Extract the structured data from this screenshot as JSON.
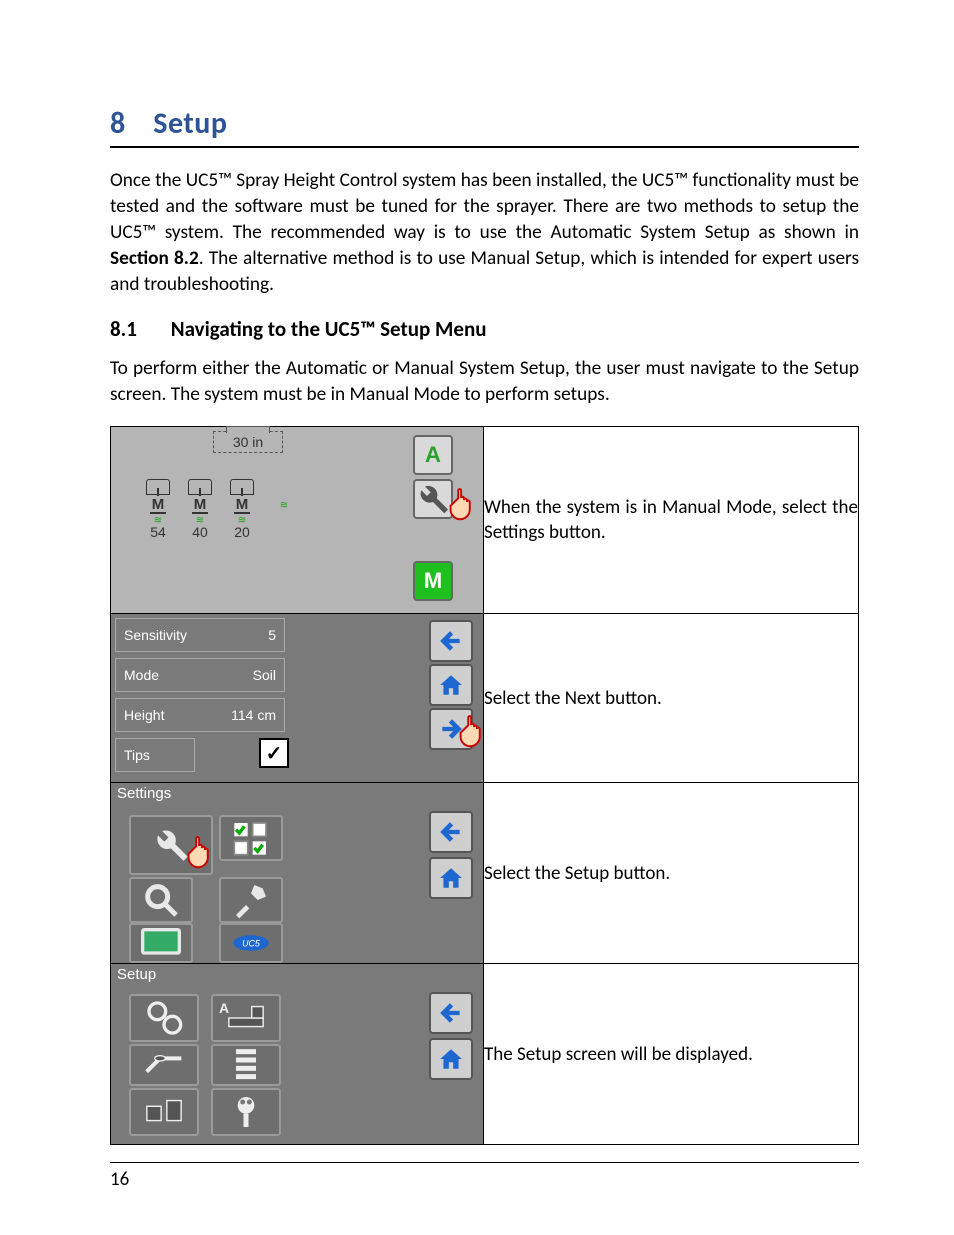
{
  "section": {
    "number": "8",
    "title": "Setup"
  },
  "intro": {
    "text_a": "Once the UC5™ Spray Height Control system has been installed, the UC5™ functionality must be tested and the software must be tuned for the sprayer.  There are two methods to setup the UC5™ system.  The recommended way is to use the Automatic System Setup as shown in ",
    "bold": "Section 8.2",
    "text_b": ".   The alternative method is to use Manual Setup, which is intended for expert users and troubleshooting."
  },
  "subsection": {
    "number": "8.1",
    "title": "Navigating to the UC5™ Setup Menu"
  },
  "sub_intro": "To perform either the Automatic or Manual System Setup, the user must navigate to the Setup screen. The system must be in Manual Mode to perform setups.",
  "steps": [
    {
      "caption": "When the system is in Manual Mode, select the Settings button."
    },
    {
      "caption": "Select the Next button."
    },
    {
      "caption": "Select the Setup button."
    },
    {
      "caption": "The Setup screen will be displayed."
    }
  ],
  "screen1": {
    "boom_height": "30 in",
    "auto_label": "A",
    "manual_label": "M",
    "sensor_letter": "M",
    "sensors": [
      {
        "value": "54"
      },
      {
        "value": "40"
      },
      {
        "value": "20"
      }
    ]
  },
  "screen2": {
    "rows": [
      {
        "label": "Sensitivity",
        "value": "5"
      },
      {
        "label": "Mode",
        "value": "Soil"
      },
      {
        "label": "Height",
        "value": "114 cm"
      },
      {
        "label": "Tips",
        "value": "✓"
      }
    ]
  },
  "screen3": {
    "title": "Settings"
  },
  "screen4": {
    "title": "Setup",
    "a_label": "A"
  },
  "page_number": "16"
}
